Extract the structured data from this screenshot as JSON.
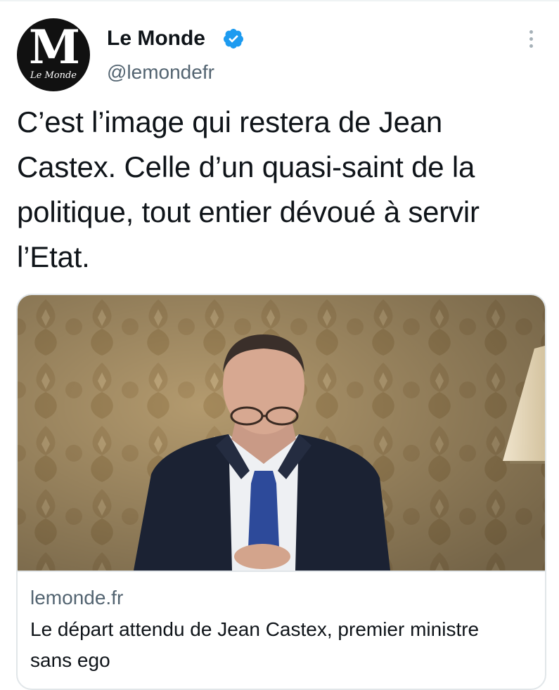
{
  "account": {
    "display_name": "Le Monde",
    "handle": "@lemondefr",
    "verified": true,
    "avatar": {
      "logo_letter": "M",
      "logo_wordmark": "Le Monde"
    }
  },
  "tweet": {
    "text": "C’est l’image qui restera de Jean Castex. Celle d’un quasi-saint de la politique, tout entier dévoué à servir l’Etat."
  },
  "card": {
    "domain": "lemonde.fr",
    "title": "Le départ attendu de Jean Castex, premier ministre sans ego"
  },
  "colors": {
    "text_primary": "#0f1419",
    "text_secondary": "#536471",
    "verified_blue": "#1d9bf0",
    "border": "#e1e6e9"
  },
  "icons": {
    "verified": "verified-badge-icon",
    "more": "more-vertical-icon"
  }
}
